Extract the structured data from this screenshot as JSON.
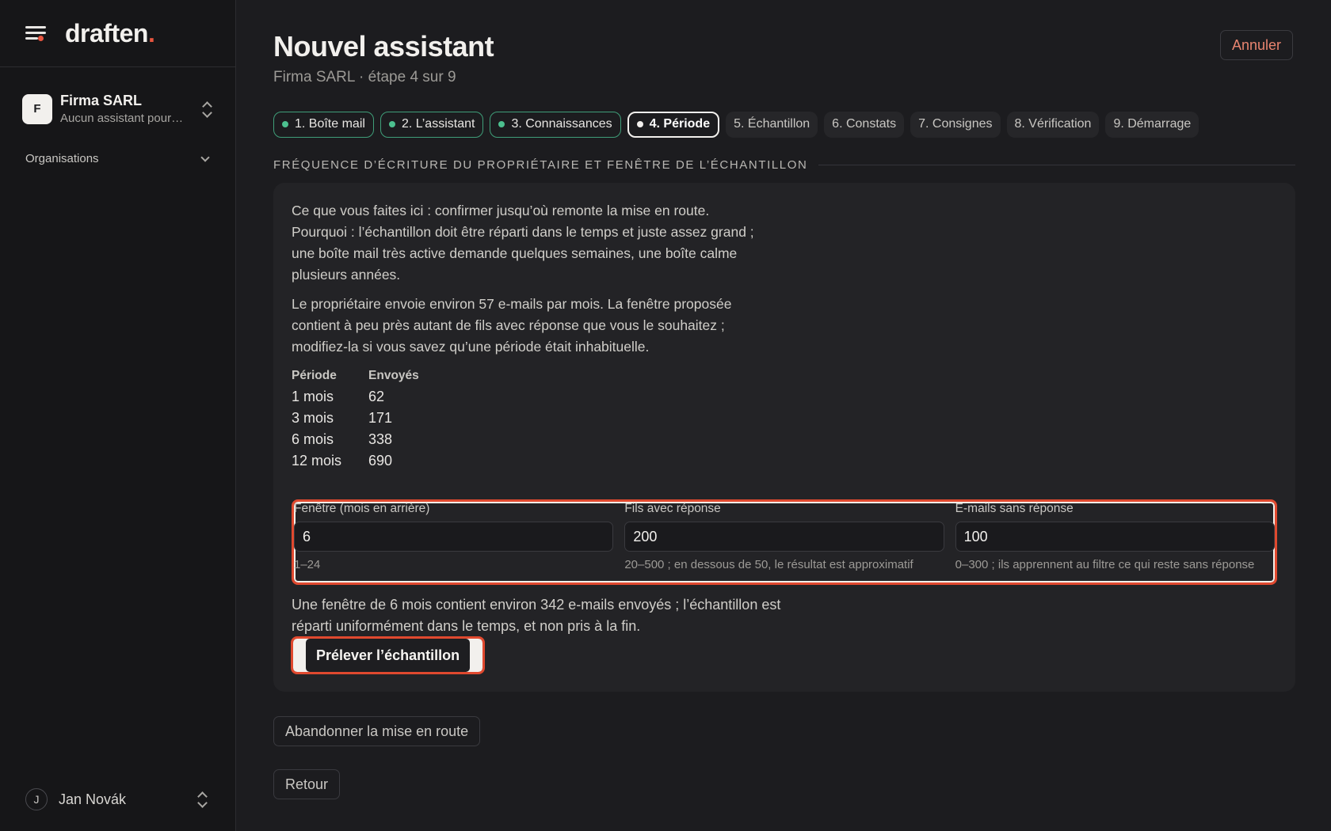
{
  "brand": {
    "name": "draften",
    "accent": "."
  },
  "sidebar": {
    "org": {
      "initial": "F",
      "name": "Firma SARL",
      "subtitle": "Aucun assistant pour…"
    },
    "nav": {
      "organisations_label": "Organisations"
    },
    "user": {
      "initial": "J",
      "name": "Jan Novák"
    }
  },
  "header": {
    "title": "Nouvel assistant",
    "subtitle": "Firma SARL · étape 4 sur 9",
    "cancel_label": "Annuler"
  },
  "steps": [
    {
      "label": "1. Boîte mail",
      "state": "done"
    },
    {
      "label": "2. L’assistant",
      "state": "done"
    },
    {
      "label": "3. Connaissances",
      "state": "done"
    },
    {
      "label": "4. Période",
      "state": "current"
    },
    {
      "label": "5. Échantillon",
      "state": "todo"
    },
    {
      "label": "6. Constats",
      "state": "todo"
    },
    {
      "label": "7. Consignes",
      "state": "todo"
    },
    {
      "label": "8. Vérification",
      "state": "todo"
    },
    {
      "label": "9. Démarrage",
      "state": "todo"
    }
  ],
  "section": {
    "title": "FRÉQUENCE D’ÉCRITURE DU PROPRIÉTAIRE ET FENÊTRE DE L’ÉCHANTILLON",
    "intro": "Ce que vous faites ici : confirmer jusqu’où remonte la mise en route. Pourquoi : l’échantillon doit être réparti dans le temps et juste assez grand ; une boîte mail très active demande quelques semaines, une boîte calme plusieurs années.",
    "explanation": "Le propriétaire envoie environ 57 e-mails par mois. La fenêtre proposée contient à peu près autant de fils avec réponse que vous le souhaitez ; modifiez-la si vous savez qu’une période était inhabituelle.",
    "table": {
      "headers": [
        "Période",
        "Envoyés"
      ],
      "rows": [
        [
          "1 mois",
          "62"
        ],
        [
          "3 mois",
          "171"
        ],
        [
          "6 mois",
          "338"
        ],
        [
          "12 mois",
          "690"
        ]
      ]
    },
    "fields": [
      {
        "label": "Fenêtre (mois en arrière)",
        "value": "6",
        "hint": "1–24"
      },
      {
        "label": "Fils avec réponse",
        "value": "200",
        "hint": "20–500 ; en dessous de 50, le résultat est approximatif"
      },
      {
        "label": "E-mails sans réponse",
        "value": "100",
        "hint": "0–300 ; ils apprennent au filtre ce qui reste sans réponse"
      }
    ],
    "summary": "Une fenêtre de 6 mois contient environ 342 e-mails envoyés ; l’échantillon est réparti uniformément dans le temps, et non pris à la fin.",
    "sample_button": "Prélever l’échantillon"
  },
  "footer": {
    "abandon_label": "Abandonner la mise en route",
    "back_label": "Retour"
  },
  "colors": {
    "accent": "#e8553f",
    "done_step": "#4cc08f",
    "highlight": "#e0492f"
  }
}
